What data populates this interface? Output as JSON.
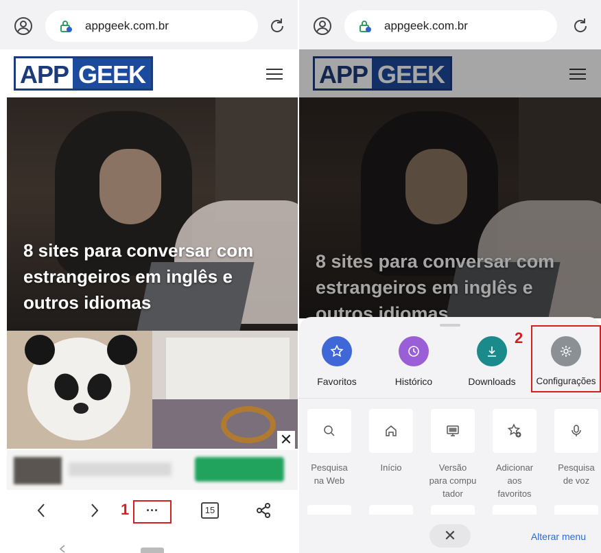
{
  "left_screen": {
    "address_bar": {
      "url": "appgeek.com.br"
    },
    "site": {
      "logo_part1": "APP",
      "logo_part2": "GEEK"
    },
    "hero": {
      "title_lines": [
        "8 sites para conversar com",
        "estrangeiros em inglês e",
        "outros idiomas"
      ]
    },
    "toolbar": {
      "tabs_count": "15",
      "annotation": "1",
      "more_label": "···"
    }
  },
  "right_screen": {
    "address_bar": {
      "url": "appgeek.com.br"
    },
    "site": {
      "logo_part1": "APP",
      "logo_part2": "GEEK"
    },
    "hero": {
      "title_lines": [
        "8 sites para conversar com",
        "estrangeiros em inglês e",
        "outros idiomas"
      ]
    },
    "menu": {
      "annotation": "2",
      "top_items": [
        {
          "label": "Favoritos",
          "color": "#3f67d8",
          "icon": "star-icon"
        },
        {
          "label": "Histórico",
          "color": "#9a5fd6",
          "icon": "history-icon"
        },
        {
          "label": "Downloads",
          "color": "#1a8a8a",
          "icon": "download-icon"
        },
        {
          "label": "Configurações",
          "color": "#8b9095",
          "icon": "gear-icon"
        }
      ],
      "grid_items": [
        {
          "label_lines": [
            "Pesquisa",
            "na Web"
          ],
          "icon": "search-icon"
        },
        {
          "label_lines": [
            "Início"
          ],
          "icon": "home-icon"
        },
        {
          "label_lines": [
            "Versão",
            "para compu",
            "tador"
          ],
          "icon": "desktop-icon"
        },
        {
          "label_lines": [
            "Adicionar",
            "aos",
            "favoritos"
          ],
          "icon": "add-favorite-icon"
        },
        {
          "label_lines": [
            "Pesquisa",
            "de voz"
          ],
          "icon": "microphone-icon"
        }
      ],
      "close_label": "✕",
      "alterar_label": "Alterar menu"
    }
  }
}
